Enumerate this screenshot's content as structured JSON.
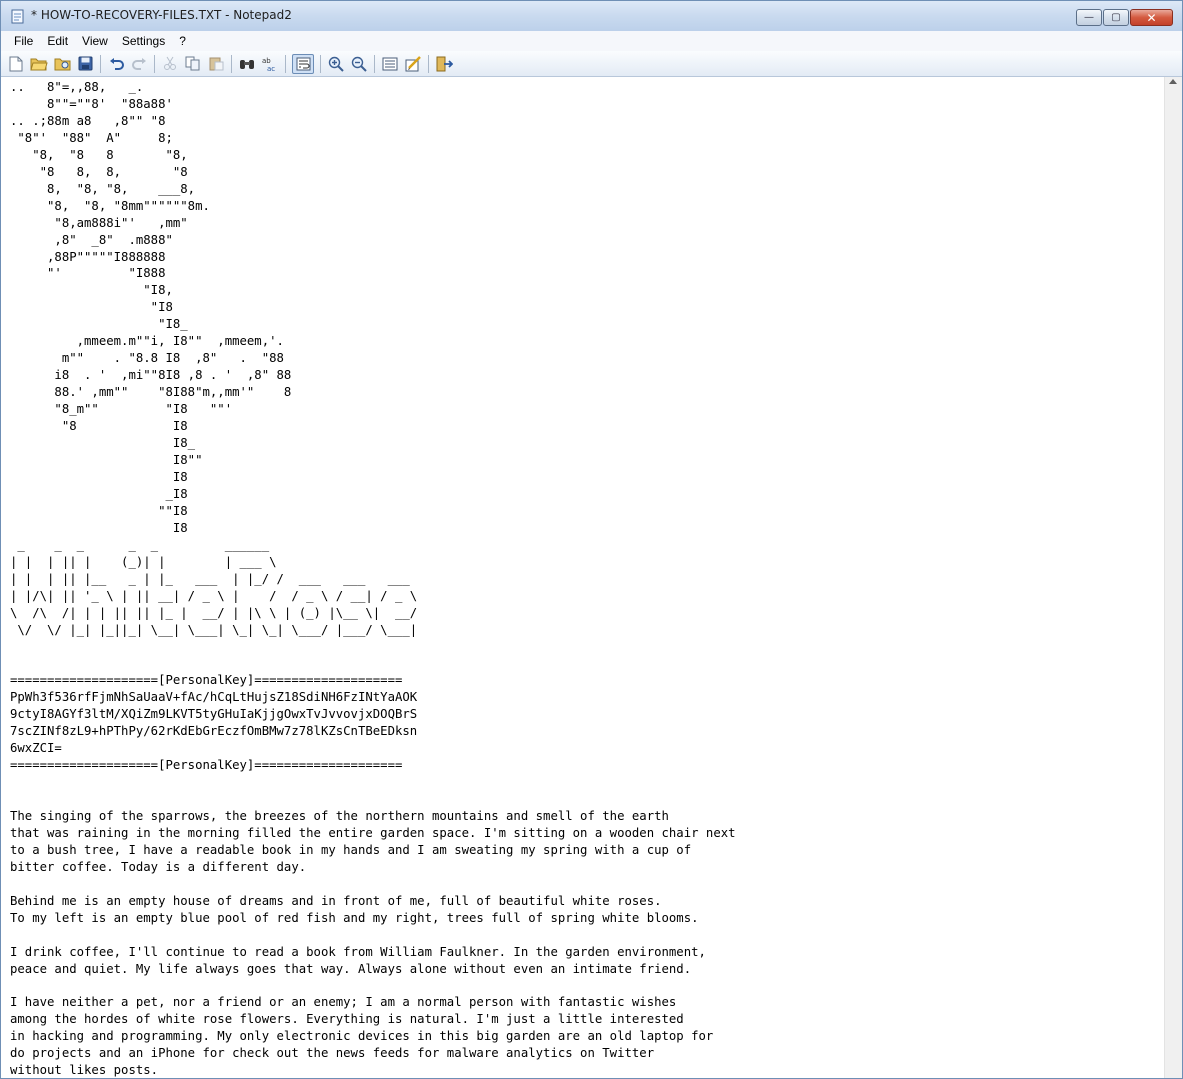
{
  "window": {
    "title": "* HOW-TO-RECOVERY-FILES.TXT - Notepad2",
    "buttons": {
      "minimize": "—",
      "maximize": "▢",
      "close": "✕"
    }
  },
  "menu": [
    {
      "label": "File"
    },
    {
      "label": "Edit"
    },
    {
      "label": "View"
    },
    {
      "label": "Settings"
    },
    {
      "label": "?"
    }
  ],
  "toolbar": {
    "buttons": [
      "new-file-icon",
      "open-folder-icon",
      "browse-icon",
      "save-icon",
      "undo-icon",
      "redo-icon",
      "cut-icon",
      "copy-icon",
      "paste-icon",
      "find-icon",
      "replace-icon",
      "word-wrap-icon",
      "zoom-in-icon",
      "zoom-out-icon",
      "scheme-icon",
      "customize-scheme-icon",
      "exit-icon"
    ]
  },
  "document": {
    "text": "..   8\"=,,88,   _.\n     8\"\"=\"\"8'  \"88a88'\n.. .;88m a8   ,8\"\" \"8\n \"8\"'  \"88\"  A\"     8;\n   \"8,  \"8   8       \"8,\n    \"8   8,  8,       \"8\n     8,  \"8, \"8,    ___8,\n     \"8,  \"8, \"8mm\"\"\"\"\"\"8m.\n      \"8,am888i\"'   ,mm\"\n      ,8\"  _8\"  .m888\"\n     ,88P\"\"\"\"\"I888888\n     \"'         \"I888\n                  \"I8,\n                   \"I8\n                    \"I8_\n         ,mmeem.m\"\"i, I8\"\"  ,mmeem,'.\n       m\"\"    . \"8.8 I8  ,8\"   .  \"88\n      i8  . '  ,mi\"\"8I8 ,8 . '  ,8\" 88\n      88.' ,mm\"\"    \"8I88\"m,,mm'\"    8\n      \"8_m\"\"         \"I8   \"\"'\n       \"8             I8\n                      I8_\n                      I8\"\"\n                      I8\n                     _I8\n                    \"\"I8\n                      I8\n _    _  _      _  _         ______\n| |  | || |    (_)| |        | ___ \\\n| |  | || |__   _ | |_   ___  | |_/ /  ___   ___   ___\n| |/\\| || '_ \\ | || __| / _ \\ |    /  / _ \\ / __| / _ \\\n\\  /\\  /| | | || || |_ |  __/ | |\\ \\ | (_) |\\__ \\|  __/\n \\/  \\/ |_| |_||_| \\__| \\___| \\_| \\_| \\___/ |___/ \\___|\n\n\n====================[PersonalKey]====================\nPpWh3f536rfFjmNhSaUaaV+fAc/hCqLtHujsZ18SdiNH6FzINtYaAOK\n9ctyI8AGYf3ltM/XQiZm9LKVT5tyGHuIaKjjgOwxTvJvvovjxDOQBrS\n7scZINf8zL9+hPThPy/62rKdEbGrEczfOmBMw7z78lKZsCnTBeEDksn\n6wxZCI=\n====================[PersonalKey]====================\n\n\nThe singing of the sparrows, the breezes of the northern mountains and smell of the earth\nthat was raining in the morning filled the entire garden space. I'm sitting on a wooden chair next\nto a bush tree, I have a readable book in my hands and I am sweating my spring with a cup of\nbitter coffee. Today is a different day.\n\nBehind me is an empty house of dreams and in front of me, full of beautiful white roses.\nTo my left is an empty blue pool of red fish and my right, trees full of spring white blooms.\n\nI drink coffee, I'll continue to read a book from William Faulkner. In the garden environment,\npeace and quiet. My life always goes that way. Always alone without even an intimate friend.\n\nI have neither a pet, nor a friend or an enemy; I am a normal person with fantastic wishes\namong the hordes of white rose flowers. Everything is natural. I'm just a little interested\nin hacking and programming. My only electronic devices in this big garden are an old laptop for\ndo projects and an iPhone for check out the news feeds for malware analytics on Twitter\nwithout likes posts."
  },
  "colors": {
    "titlebar": "#c9daef",
    "close_button": "#d45a40",
    "toolbar_bg": "#e3ebf5"
  }
}
